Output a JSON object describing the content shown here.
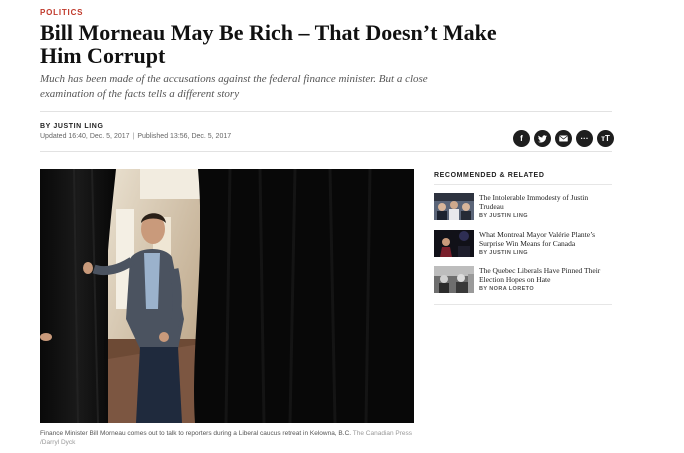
{
  "article": {
    "section": "POLITICS",
    "headline": "Bill Morneau May Be Rich – That Doesn’t Make Him Corrupt",
    "deck": "Much has been made of the accusations against the federal finance minister. But a close examination of the facts tells a different story",
    "byline": "BY JUSTIN LING",
    "updated": "Updated 16:40, Dec. 5, 2017",
    "separator": "|",
    "published": "Published 13:56, Dec. 5, 2017",
    "caption": "Finance Minister Bill Morneau comes out to talk to reporters during a Liberal caucus retreat in Kelowna, B.C.",
    "credit": "The Canadian Press /Darryl Dyck"
  },
  "share": {
    "facebook_glyph": "f",
    "more_glyph": "···",
    "text_size_glyph": "ᴛT",
    "icons": [
      "facebook-icon",
      "twitter-icon",
      "email-icon",
      "more-icon",
      "text-size-icon"
    ]
  },
  "related": {
    "heading": "RECOMMENDED & RELATED",
    "items": [
      {
        "title": "The Intolerable Immodesty of Justin Trudeau",
        "author": "BY JUSTIN LING"
      },
      {
        "title": "What Montreal Mayor Valérie Plante’s Surprise Win Means for Canada",
        "author": "BY JUSTIN LING"
      },
      {
        "title": "The Quebec Liberals Have Pinned Their Election Hopes on Hate",
        "author": "BY NORA LORETO"
      }
    ]
  },
  "colors": {
    "section_red": "#c0392b",
    "share_button": "#1e1e1e"
  }
}
